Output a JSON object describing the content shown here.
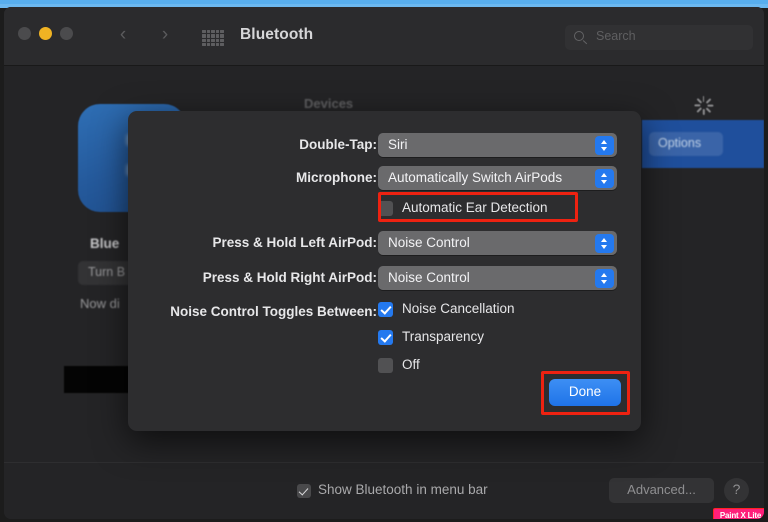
{
  "window": {
    "title": "Bluetooth",
    "traffic_lights": [
      "close",
      "minimize",
      "zoom"
    ],
    "nav_back_icon": "chevron-left-icon",
    "nav_forward_icon": "chevron-right-icon",
    "grid_icon": "show-all-grid-icon"
  },
  "search": {
    "placeholder": "Search",
    "value": "",
    "icon": "search-icon"
  },
  "background": {
    "devices_header": "Devices",
    "bluetooth_icon": "bluetooth-app-icon",
    "device_name": "Blue",
    "turn_button_label": "Turn B",
    "status_text": "Now di",
    "options_button_label": "Options",
    "spinner_icon": "loading-spinner-icon"
  },
  "dialog": {
    "rows": [
      {
        "label": "Double-Tap:",
        "value": "Siri",
        "control": "popup-button"
      },
      {
        "label": "Microphone:",
        "value": "Automatically Switch AirPods",
        "control": "popup-button"
      },
      {
        "label": "Press & Hold Left AirPod:",
        "value": "Noise Control",
        "control": "popup-button"
      },
      {
        "label": "Press & Hold Right AirPod:",
        "value": "Noise Control",
        "control": "popup-button"
      }
    ],
    "ear_detection": {
      "label": "Automatic Ear Detection",
      "checked": false
    },
    "noise_toggles_label": "Noise Control Toggles Between:",
    "noise_toggles": [
      {
        "label": "Noise Cancellation",
        "checked": true
      },
      {
        "label": "Transparency",
        "checked": true
      },
      {
        "label": "Off",
        "checked": false
      }
    ],
    "done_label": "Done"
  },
  "bottom": {
    "show_in_menu_bar_label": "Show Bluetooth in menu bar",
    "show_in_menu_bar_checked": true,
    "advanced_label": "Advanced...",
    "help_label": "?"
  },
  "watermark": {
    "text": "Paint X Lite"
  },
  "colors": {
    "accent_blue": "#2479ef",
    "highlight_red": "#ee2211",
    "window_bg": "#262628",
    "dialog_bg": "#2d2d2f",
    "popup_bg": "#6a6a6c",
    "watermark_pink": "#ff1f7a",
    "traffic_yellow": "#f0b323"
  }
}
